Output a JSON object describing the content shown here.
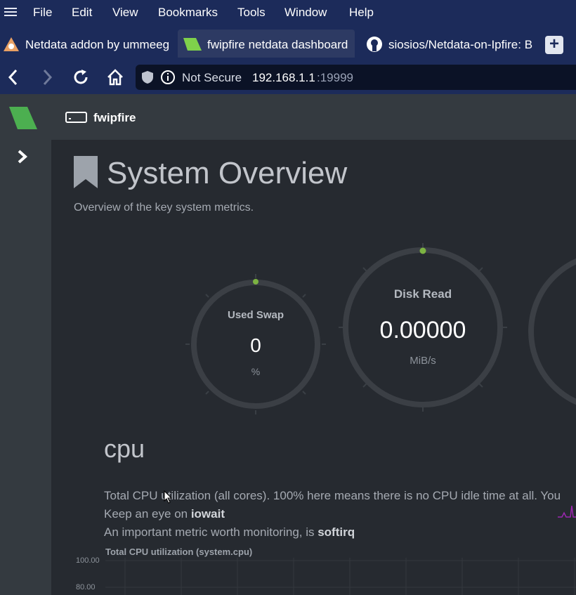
{
  "menubar": {
    "items": [
      "File",
      "Edit",
      "View",
      "Bookmarks",
      "Tools",
      "Window",
      "Help"
    ]
  },
  "tabs": [
    {
      "label": "Netdata addon by ummeeg"
    },
    {
      "label": "fwipfire netdata dashboard"
    },
    {
      "label": "siosios/Netdata-on-Ipfire: B"
    }
  ],
  "url": {
    "security": "Not Secure",
    "host": "192.168.1.1",
    "port": ":19999"
  },
  "header": {
    "hostname": "fwipfire"
  },
  "page": {
    "title": "System Overview",
    "subtitle": "Overview of the key system metrics."
  },
  "gauges": [
    {
      "label": "Used Swap",
      "value": "0",
      "unit": "%",
      "level": 0
    },
    {
      "label": "Disk Read",
      "value": "0.00000",
      "unit": "MiB/s",
      "level": 0
    }
  ],
  "cpu": {
    "heading": "cpu",
    "line1": "Total CPU utilization (all cores). 100% here means there is no CPU idle time at all. You",
    "line2_prefix": "Keep an eye on ",
    "line2_bold": "iowait",
    "line3_prefix": "An important metric worth monitoring, is ",
    "line3_bold": "softirq",
    "chart_title": "Total CPU utilization (system.cpu)",
    "yticks": [
      "100.00",
      "80.00"
    ]
  },
  "colors": {
    "accent": "#7cb342",
    "menubar": "#1c2b5a",
    "sparkline": "#9c27b0"
  }
}
